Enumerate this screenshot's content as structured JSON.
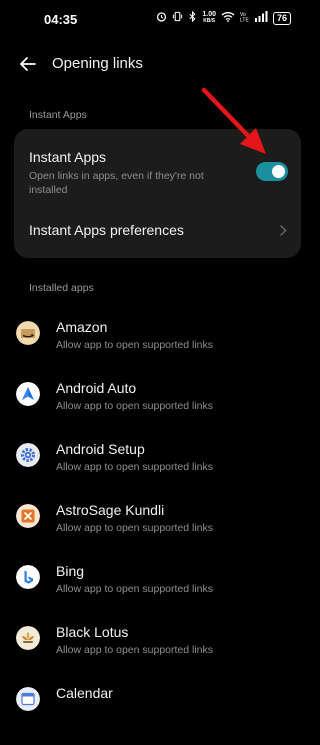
{
  "status_bar": {
    "time": "04:35",
    "speed_value": "1.00",
    "speed_unit": "KB/S",
    "battery": "76"
  },
  "header": {
    "title": "Opening links"
  },
  "instant_section": {
    "header": "Instant Apps",
    "toggle_title": "Instant Apps",
    "toggle_desc": "Open links in apps, even if they're not installed",
    "toggle_on": true,
    "preferences_label": "Instant Apps preferences"
  },
  "installed_section": {
    "header": "Installed apps",
    "apps": [
      {
        "name": "Amazon",
        "desc": "Allow app to open supported links",
        "icon": "amazon-icon"
      },
      {
        "name": "Android Auto",
        "desc": "Allow app to open supported links",
        "icon": "android-auto-icon"
      },
      {
        "name": "Android Setup",
        "desc": "Allow app to open supported links",
        "icon": "gear-icon"
      },
      {
        "name": "AstroSage Kundli",
        "desc": "Allow app to open supported links",
        "icon": "astrosage-icon"
      },
      {
        "name": "Bing",
        "desc": "Allow app to open supported links",
        "icon": "bing-icon"
      },
      {
        "name": "Black Lotus",
        "desc": "Allow app to open supported links",
        "icon": "lotus-icon"
      },
      {
        "name": "Calendar",
        "desc": "",
        "icon": "calendar-icon"
      }
    ]
  },
  "colors": {
    "background": "#000000",
    "card": "#1c1c1c",
    "toggle_on": "#1a8fa0",
    "annotation_arrow": "#e5161b"
  }
}
